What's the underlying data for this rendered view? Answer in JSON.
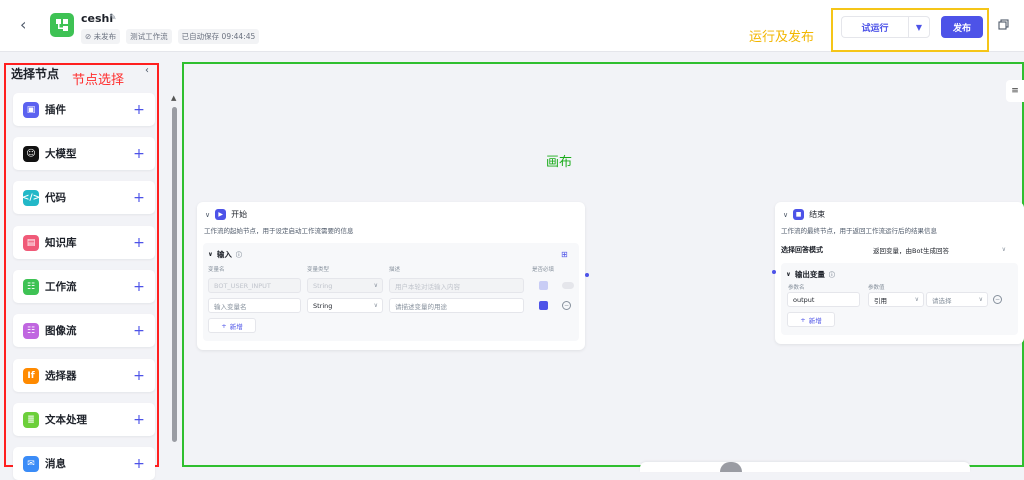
{
  "header": {
    "back_icon": "chevron-left-icon",
    "app_icon": "workflow-icon",
    "app_name": "ceshi",
    "edit_icon": "edit-icon",
    "status": "⊘ 未发布",
    "type_tag": "测试工作流",
    "autosave": "已自动保存 09:44:45",
    "annotation": "运行及发布",
    "try_run": "试运行",
    "publish": "发布",
    "copy_icon": "copy-icon"
  },
  "sidebar": {
    "title": "选择节点",
    "annotation": "节点选择",
    "items": [
      {
        "label": "插件",
        "icon": "plugin-icon",
        "color": "#5b62f0"
      },
      {
        "label": "大模型",
        "icon": "llm-icon",
        "color": "#111111"
      },
      {
        "label": "代码",
        "icon": "code-icon",
        "color": "#22b8c8"
      },
      {
        "label": "知识库",
        "icon": "knowledge-icon",
        "color": "#f05a78"
      },
      {
        "label": "工作流",
        "icon": "workflow-icon",
        "color": "#3ec254"
      },
      {
        "label": "图像流",
        "icon": "imageflow-icon",
        "color": "#c066e0"
      },
      {
        "label": "选择器",
        "icon": "selector-icon",
        "color": "#ff8a00"
      },
      {
        "label": "文本处理",
        "icon": "text-process-icon",
        "color": "#6ccf3a"
      },
      {
        "label": "消息",
        "icon": "message-icon",
        "color": "#3b8cf7"
      }
    ]
  },
  "canvas": {
    "annotation": "画布",
    "start_node": {
      "title": "开始",
      "desc": "工作流的起始节点，用于设定启动工作流需要的信息",
      "input_title": "输入",
      "col_name": "变量名",
      "col_type": "变量类型",
      "col_desc": "描述",
      "col_required": "是否必填",
      "row1": {
        "name": "BOT_USER_INPUT",
        "type": "String",
        "desc": "用户本轮对话输入内容"
      },
      "row2": {
        "name_placeholder": "输入变量名",
        "type": "String",
        "desc_placeholder": "请描述变量的用途"
      },
      "add_label": "新增"
    },
    "end_node": {
      "title": "结束",
      "desc": "工作流的最终节点，用于返回工作流运行后的结果信息",
      "mode_label": "选择回答模式",
      "mode_value": "返回变量，由Bot生成回答",
      "output_title": "输出变量",
      "col_name": "参数名",
      "col_value": "参数值",
      "param_name": "output",
      "ref_type": "引用",
      "ref_placeholder": "请选择",
      "add_label": "新增"
    }
  }
}
